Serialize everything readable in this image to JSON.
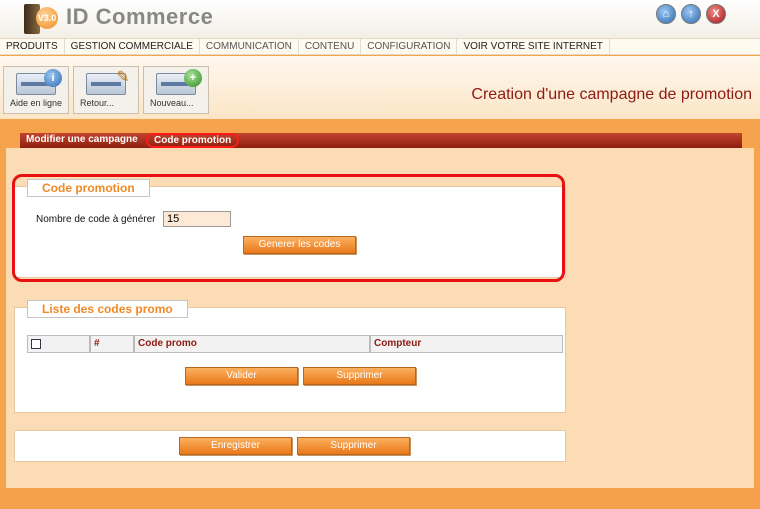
{
  "header": {
    "badge": "V3.0",
    "title": "ID Commerce",
    "icons": [
      "home-icon",
      "up-arrow-icon",
      "close-icon"
    ]
  },
  "menu": {
    "items": [
      "PRODUITS",
      "GESTION COMMERCIALE",
      "COMMUNICATION",
      "CONTENU",
      "CONFIGURATION",
      "VOIR VOTRE SITE INTERNET"
    ]
  },
  "toolbar": {
    "buttons": [
      {
        "label": "Aide en ligne",
        "icon": "info-icon"
      },
      {
        "label": "Retour...",
        "icon": "edit-pen-icon"
      },
      {
        "label": "Nouveau...",
        "icon": "add-plus-icon"
      }
    ],
    "page_title": "Creation d'une campagne de promotion"
  },
  "tabs": [
    {
      "label": "Modifier une campagne",
      "active": false
    },
    {
      "label": "Code promotion",
      "active": true
    }
  ],
  "code_section": {
    "legend": "Code promotion",
    "count_label": "Nombre de code à générer",
    "count_value": "15",
    "generate_button": "Generer les codes"
  },
  "list_section": {
    "legend": "Liste des codes promo",
    "columns": [
      "#",
      "Code promo",
      "Compteur"
    ],
    "validate_button": "Valider",
    "delete_button": "Supprimer"
  },
  "actions": {
    "save_button": "Enregistrer",
    "delete_button": "Supprimer"
  },
  "colors": {
    "accent": "#f08a24",
    "title_red": "#8e1a12",
    "background": "#f6a34e",
    "highlight": "#e81010"
  }
}
